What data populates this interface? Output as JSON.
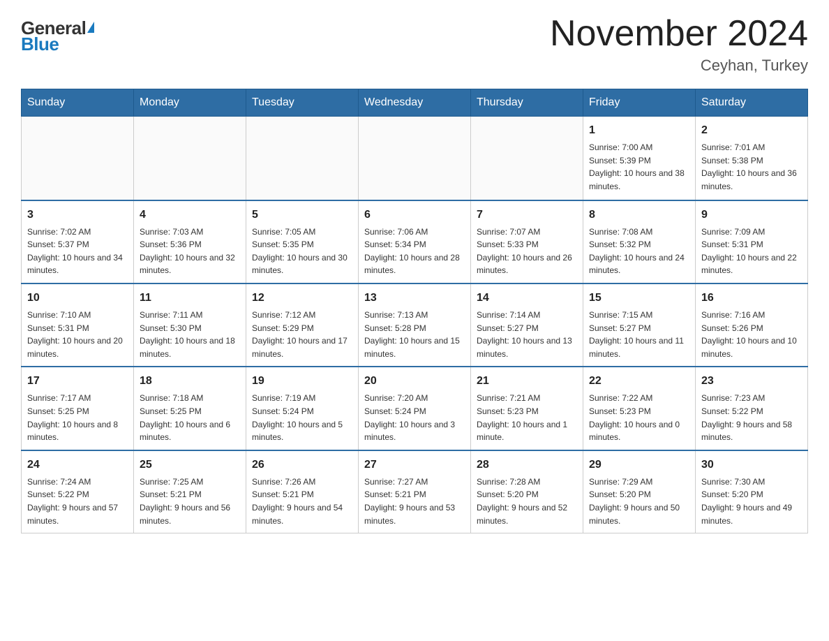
{
  "header": {
    "logo_general": "General",
    "logo_blue": "Blue",
    "month_title": "November 2024",
    "location": "Ceyhan, Turkey"
  },
  "weekdays": [
    "Sunday",
    "Monday",
    "Tuesday",
    "Wednesday",
    "Thursday",
    "Friday",
    "Saturday"
  ],
  "weeks": [
    [
      {
        "day": "",
        "sunrise": "",
        "sunset": "",
        "daylight": ""
      },
      {
        "day": "",
        "sunrise": "",
        "sunset": "",
        "daylight": ""
      },
      {
        "day": "",
        "sunrise": "",
        "sunset": "",
        "daylight": ""
      },
      {
        "day": "",
        "sunrise": "",
        "sunset": "",
        "daylight": ""
      },
      {
        "day": "",
        "sunrise": "",
        "sunset": "",
        "daylight": ""
      },
      {
        "day": "1",
        "sunrise": "Sunrise: 7:00 AM",
        "sunset": "Sunset: 5:39 PM",
        "daylight": "Daylight: 10 hours and 38 minutes."
      },
      {
        "day": "2",
        "sunrise": "Sunrise: 7:01 AM",
        "sunset": "Sunset: 5:38 PM",
        "daylight": "Daylight: 10 hours and 36 minutes."
      }
    ],
    [
      {
        "day": "3",
        "sunrise": "Sunrise: 7:02 AM",
        "sunset": "Sunset: 5:37 PM",
        "daylight": "Daylight: 10 hours and 34 minutes."
      },
      {
        "day": "4",
        "sunrise": "Sunrise: 7:03 AM",
        "sunset": "Sunset: 5:36 PM",
        "daylight": "Daylight: 10 hours and 32 minutes."
      },
      {
        "day": "5",
        "sunrise": "Sunrise: 7:05 AM",
        "sunset": "Sunset: 5:35 PM",
        "daylight": "Daylight: 10 hours and 30 minutes."
      },
      {
        "day": "6",
        "sunrise": "Sunrise: 7:06 AM",
        "sunset": "Sunset: 5:34 PM",
        "daylight": "Daylight: 10 hours and 28 minutes."
      },
      {
        "day": "7",
        "sunrise": "Sunrise: 7:07 AM",
        "sunset": "Sunset: 5:33 PM",
        "daylight": "Daylight: 10 hours and 26 minutes."
      },
      {
        "day": "8",
        "sunrise": "Sunrise: 7:08 AM",
        "sunset": "Sunset: 5:32 PM",
        "daylight": "Daylight: 10 hours and 24 minutes."
      },
      {
        "day": "9",
        "sunrise": "Sunrise: 7:09 AM",
        "sunset": "Sunset: 5:31 PM",
        "daylight": "Daylight: 10 hours and 22 minutes."
      }
    ],
    [
      {
        "day": "10",
        "sunrise": "Sunrise: 7:10 AM",
        "sunset": "Sunset: 5:31 PM",
        "daylight": "Daylight: 10 hours and 20 minutes."
      },
      {
        "day": "11",
        "sunrise": "Sunrise: 7:11 AM",
        "sunset": "Sunset: 5:30 PM",
        "daylight": "Daylight: 10 hours and 18 minutes."
      },
      {
        "day": "12",
        "sunrise": "Sunrise: 7:12 AM",
        "sunset": "Sunset: 5:29 PM",
        "daylight": "Daylight: 10 hours and 17 minutes."
      },
      {
        "day": "13",
        "sunrise": "Sunrise: 7:13 AM",
        "sunset": "Sunset: 5:28 PM",
        "daylight": "Daylight: 10 hours and 15 minutes."
      },
      {
        "day": "14",
        "sunrise": "Sunrise: 7:14 AM",
        "sunset": "Sunset: 5:27 PM",
        "daylight": "Daylight: 10 hours and 13 minutes."
      },
      {
        "day": "15",
        "sunrise": "Sunrise: 7:15 AM",
        "sunset": "Sunset: 5:27 PM",
        "daylight": "Daylight: 10 hours and 11 minutes."
      },
      {
        "day": "16",
        "sunrise": "Sunrise: 7:16 AM",
        "sunset": "Sunset: 5:26 PM",
        "daylight": "Daylight: 10 hours and 10 minutes."
      }
    ],
    [
      {
        "day": "17",
        "sunrise": "Sunrise: 7:17 AM",
        "sunset": "Sunset: 5:25 PM",
        "daylight": "Daylight: 10 hours and 8 minutes."
      },
      {
        "day": "18",
        "sunrise": "Sunrise: 7:18 AM",
        "sunset": "Sunset: 5:25 PM",
        "daylight": "Daylight: 10 hours and 6 minutes."
      },
      {
        "day": "19",
        "sunrise": "Sunrise: 7:19 AM",
        "sunset": "Sunset: 5:24 PM",
        "daylight": "Daylight: 10 hours and 5 minutes."
      },
      {
        "day": "20",
        "sunrise": "Sunrise: 7:20 AM",
        "sunset": "Sunset: 5:24 PM",
        "daylight": "Daylight: 10 hours and 3 minutes."
      },
      {
        "day": "21",
        "sunrise": "Sunrise: 7:21 AM",
        "sunset": "Sunset: 5:23 PM",
        "daylight": "Daylight: 10 hours and 1 minute."
      },
      {
        "day": "22",
        "sunrise": "Sunrise: 7:22 AM",
        "sunset": "Sunset: 5:23 PM",
        "daylight": "Daylight: 10 hours and 0 minutes."
      },
      {
        "day": "23",
        "sunrise": "Sunrise: 7:23 AM",
        "sunset": "Sunset: 5:22 PM",
        "daylight": "Daylight: 9 hours and 58 minutes."
      }
    ],
    [
      {
        "day": "24",
        "sunrise": "Sunrise: 7:24 AM",
        "sunset": "Sunset: 5:22 PM",
        "daylight": "Daylight: 9 hours and 57 minutes."
      },
      {
        "day": "25",
        "sunrise": "Sunrise: 7:25 AM",
        "sunset": "Sunset: 5:21 PM",
        "daylight": "Daylight: 9 hours and 56 minutes."
      },
      {
        "day": "26",
        "sunrise": "Sunrise: 7:26 AM",
        "sunset": "Sunset: 5:21 PM",
        "daylight": "Daylight: 9 hours and 54 minutes."
      },
      {
        "day": "27",
        "sunrise": "Sunrise: 7:27 AM",
        "sunset": "Sunset: 5:21 PM",
        "daylight": "Daylight: 9 hours and 53 minutes."
      },
      {
        "day": "28",
        "sunrise": "Sunrise: 7:28 AM",
        "sunset": "Sunset: 5:20 PM",
        "daylight": "Daylight: 9 hours and 52 minutes."
      },
      {
        "day": "29",
        "sunrise": "Sunrise: 7:29 AM",
        "sunset": "Sunset: 5:20 PM",
        "daylight": "Daylight: 9 hours and 50 minutes."
      },
      {
        "day": "30",
        "sunrise": "Sunrise: 7:30 AM",
        "sunset": "Sunset: 5:20 PM",
        "daylight": "Daylight: 9 hours and 49 minutes."
      }
    ]
  ]
}
